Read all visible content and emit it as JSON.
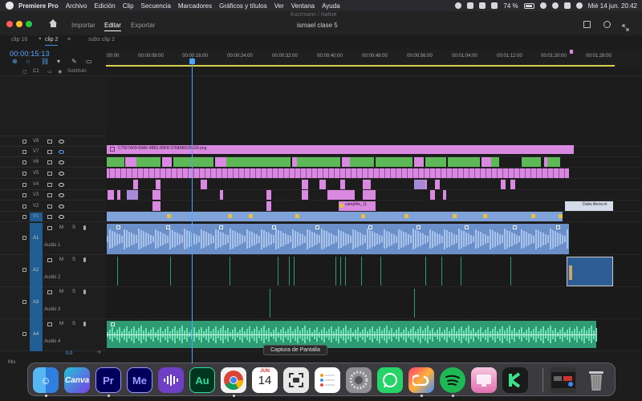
{
  "menubar": {
    "items": [
      "Premiere Pro",
      "Archivo",
      "Edición",
      "Clip",
      "Secuencia",
      "Marcadores",
      "Gráficos y títulos",
      "Ver",
      "Ventana",
      "Ayuda"
    ],
    "battery": "74 %",
    "datetime": "Mié 14 jun.  20:42"
  },
  "header": {
    "tabs": [
      "Importar",
      "Editar",
      "Exportar"
    ],
    "active_tab": "Editar",
    "project": "ismael clase 5",
    "window_title": "Kurzmann / Native"
  },
  "timeline": {
    "sequence_tabs": [
      "clip 16",
      "clip 2",
      "subs clip 2"
    ],
    "active_sequence": "clip 2",
    "timecode": "00:00:15:13",
    "ruler": [
      ":00:00",
      "00:00:08:00",
      "00:00:16:00",
      "00:00:24:00",
      "00:00:32:00",
      "00:00:40:00",
      "00:00:48:00",
      "00:00:56:00",
      "00:01:04:00",
      "00:01:12:00",
      "00:01:20:00",
      "00:01:28:00"
    ],
    "subtitle_track": {
      "id": "C1",
      "label": "Subtítulo"
    },
    "video_tracks": [
      "V8",
      "V7",
      "V6",
      "V5",
      "V4",
      "V3",
      "V2",
      "V1"
    ],
    "audio_tracks": [
      {
        "id": "A1",
        "name": "Audio 1"
      },
      {
        "id": "A2",
        "name": "Audio 2"
      },
      {
        "id": "A3",
        "name": "Audio 3"
      },
      {
        "id": "A4",
        "name": "Audio 4"
      }
    ],
    "clip_labels": {
      "v7": "C7567A09-89AF-4B81-89F8-3768A86D8E09.png",
      "v2": "campfire_11",
      "v1_end": "Dubs libros.m"
    },
    "volume": "0,0",
    "master_label": "Mix",
    "ms": "M",
    "solo": "S",
    "fx": "fx"
  },
  "toast": "Captura de Pantalla",
  "dock": {
    "apps": [
      "Finder",
      "Canva",
      "Premiere Pro",
      "Media Encoder",
      "Podcast",
      "Audition",
      "Chrome",
      "Calendario",
      "Captura",
      "Recordatorios",
      "Preferencias",
      "WhatsApp",
      "Creative Cloud",
      "Spotify",
      "CleanMyMac",
      "Kinemaster",
      "Ventana",
      "Papelera"
    ],
    "canva": "Canva",
    "pr": "Pr",
    "me": "Me",
    "au": "Au",
    "cal_month": "JUN",
    "cal_day": "14"
  },
  "colors": {
    "accent": "#4aa3ff",
    "graphic_clip": "#d98ae0",
    "video_clip": "#7fa3d8",
    "audio_clip": "#2e9b75",
    "green_clip": "#5fb858"
  }
}
